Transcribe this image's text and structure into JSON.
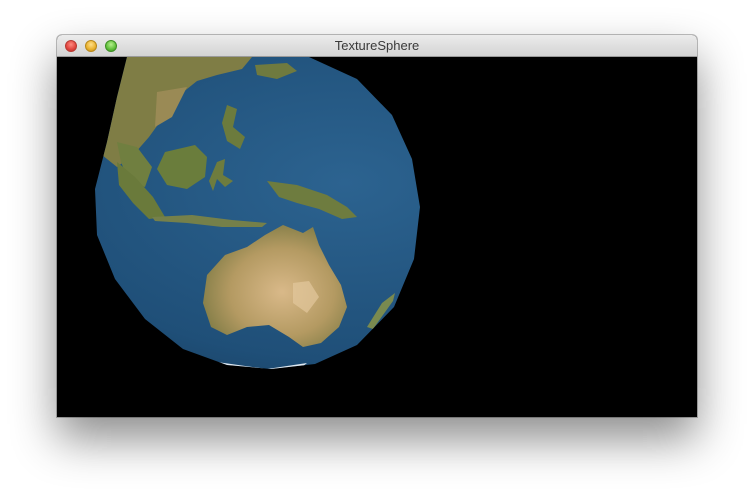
{
  "window": {
    "title": "TextureSphere",
    "controls": {
      "close_color": "#e0443e",
      "minimize_color": "#e9b12e",
      "zoom_color": "#5fbf3a"
    }
  },
  "scene": {
    "background_color": "#000000",
    "object": "textured-earth-sphere",
    "ocean_color": "#1f4f78",
    "land_color": "#8a7a45"
  }
}
